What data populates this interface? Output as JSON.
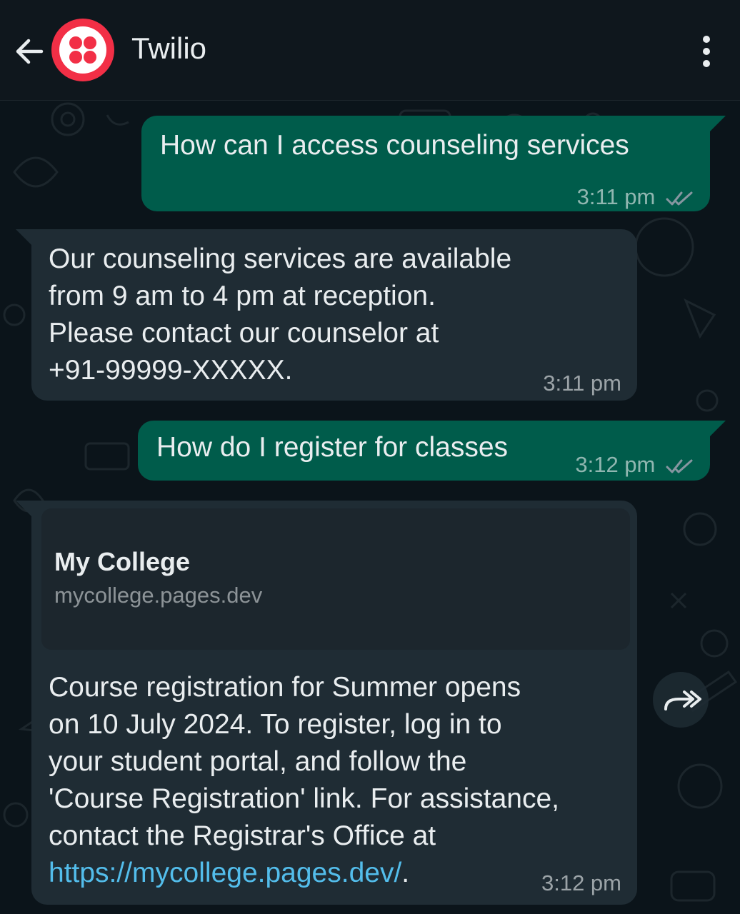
{
  "header": {
    "title": "Twilio",
    "icons": {
      "back": "arrow-left-icon",
      "avatar": "twilio-logo",
      "menu": "more-vertical-icon"
    }
  },
  "messages": [
    {
      "direction": "outgoing",
      "text": "How can I access counseling services",
      "time": "3:11 pm",
      "status": "read"
    },
    {
      "direction": "incoming",
      "lines": [
        "Our counseling services are available",
        "from 9 am to 4 pm at reception.",
        "Please contact our counselor at",
        "+91-99999-XXXXX."
      ],
      "time": "3:11 pm"
    },
    {
      "direction": "outgoing",
      "text": "How do I register for classes",
      "time": "3:12 pm",
      "status": "read"
    },
    {
      "direction": "incoming",
      "link_preview": {
        "title": "My College",
        "domain": "mycollege.pages.dev"
      },
      "lines": [
        "Course registration for Summer opens",
        "on 10 July 2024. To register, log in to",
        "your student portal, and follow the",
        "'Course Registration' link. For assistance,",
        "contact the Registrar's Office at"
      ],
      "link": "https://mycollege.pages.dev/",
      "link_suffix": ".",
      "time": "3:12 pm"
    }
  ],
  "colors": {
    "outgoing_bubble": "#005c4b",
    "incoming_bubble": "#1f2c34",
    "background": "#0b141a",
    "link": "#53bdeb",
    "read_ticks": "#8696a0"
  }
}
